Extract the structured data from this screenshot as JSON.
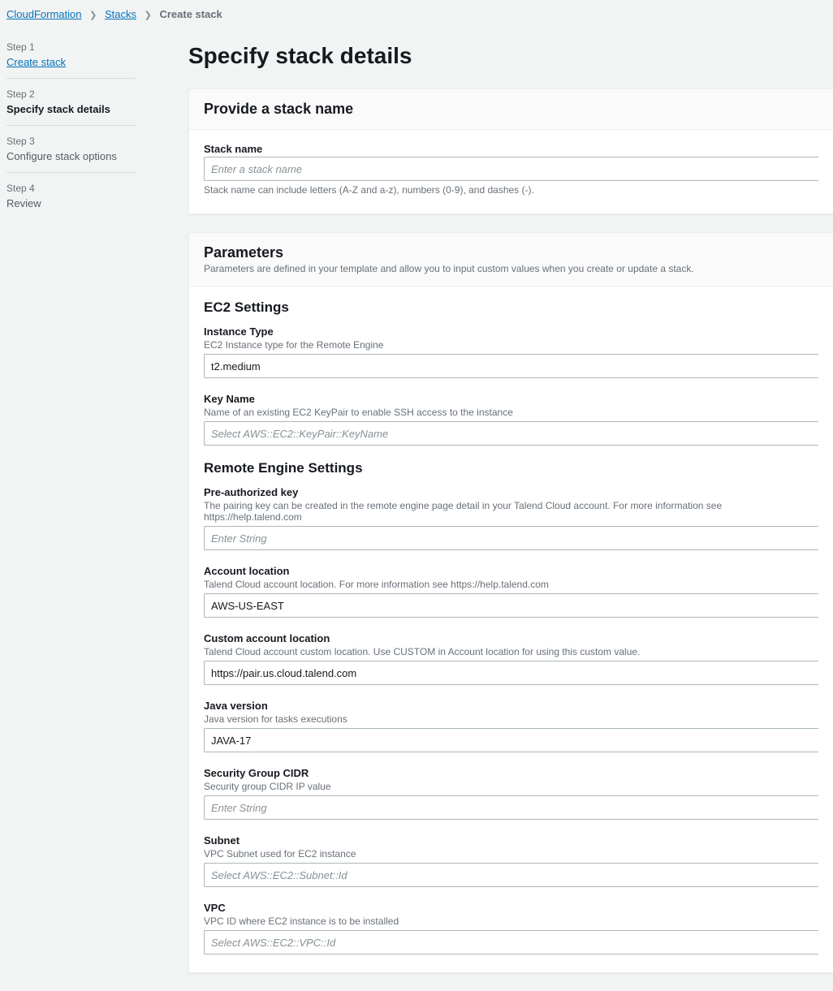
{
  "breadcrumb": {
    "root": "CloudFormation",
    "mid": "Stacks",
    "current": "Create stack"
  },
  "steps": [
    {
      "num": "Step 1",
      "name": "Create stack",
      "state": "link"
    },
    {
      "num": "Step 2",
      "name": "Specify stack details",
      "state": "active"
    },
    {
      "num": "Step 3",
      "name": "Configure stack options",
      "state": "plain"
    },
    {
      "num": "Step 4",
      "name": "Review",
      "state": "plain"
    }
  ],
  "page_title": "Specify stack details",
  "stack_name_panel": {
    "title": "Provide a stack name",
    "label": "Stack name",
    "placeholder": "Enter a stack name",
    "help": "Stack name can include letters (A-Z and a-z), numbers (0-9), and dashes (-)."
  },
  "params_panel": {
    "title": "Parameters",
    "desc": "Parameters are defined in your template and allow you to input custom values when you create or update a stack."
  },
  "ec2": {
    "title": "EC2 Settings",
    "instance_type": {
      "label": "Instance Type",
      "desc": "EC2 Instance type for the Remote Engine",
      "value": "t2.medium"
    },
    "key_name": {
      "label": "Key Name",
      "desc": "Name of an existing EC2 KeyPair to enable SSH access to the instance",
      "placeholder": "Select AWS::EC2::KeyPair::KeyName"
    }
  },
  "re": {
    "title": "Remote Engine Settings",
    "pre_key": {
      "label": "Pre-authorized key",
      "desc": "The pairing key can be created in the remote engine page detail in your Talend Cloud account. For more information see https://help.talend.com",
      "placeholder": "Enter String"
    },
    "acct_loc": {
      "label": "Account location",
      "desc": "Talend Cloud account location. For more information see https://help.talend.com",
      "value": "AWS-US-EAST"
    },
    "custom_loc": {
      "label": "Custom account location",
      "desc": "Talend Cloud account custom location. Use CUSTOM in Account location for using this custom value.",
      "value": "https://pair.us.cloud.talend.com"
    },
    "java": {
      "label": "Java version",
      "desc": "Java version for tasks executions",
      "value": "JAVA-17"
    },
    "sg_cidr": {
      "label": "Security Group  CIDR",
      "desc": "Security group CIDR IP value",
      "placeholder": "Enter String"
    },
    "subnet": {
      "label": "Subnet",
      "desc": "VPC Subnet used for EC2 instance",
      "placeholder": "Select AWS::EC2::Subnet::Id"
    },
    "vpc": {
      "label": "VPC",
      "desc": "VPC ID where EC2 instance is to be installed",
      "placeholder": "Select AWS::EC2::VPC::Id"
    }
  }
}
